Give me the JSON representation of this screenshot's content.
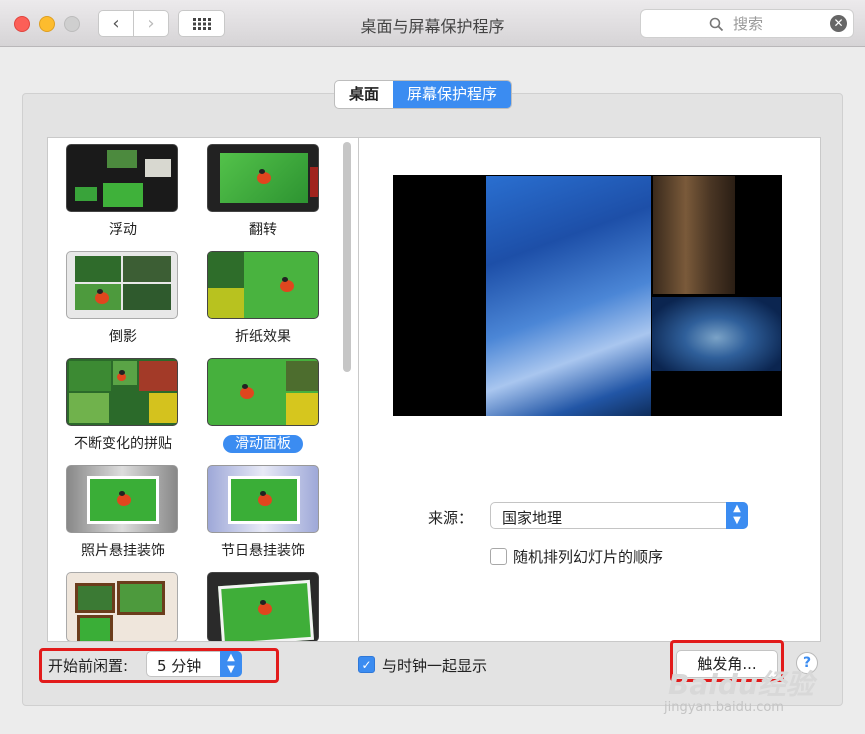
{
  "window": {
    "title": "桌面与屏幕保护程序"
  },
  "toolbar": {
    "back_icon": "chevron-left-icon",
    "forward_icon": "chevron-right-icon",
    "grid_icon": "grid-icon"
  },
  "search": {
    "placeholder": "搜索"
  },
  "tabs": [
    {
      "label": "桌面",
      "selected": false
    },
    {
      "label": "屏幕保护程序",
      "selected": true
    }
  ],
  "screensavers": [
    {
      "label": "浮动",
      "selected": false
    },
    {
      "label": "翻转",
      "selected": false
    },
    {
      "label": "倒影",
      "selected": false
    },
    {
      "label": "折纸效果",
      "selected": false
    },
    {
      "label": "不断变化的拼贴",
      "selected": false
    },
    {
      "label": "滑动面板",
      "selected": true
    },
    {
      "label": "照片悬挂装饰",
      "selected": false
    },
    {
      "label": "节日悬挂装饰",
      "selected": false
    }
  ],
  "source": {
    "label": "来源：",
    "value": "国家地理"
  },
  "shuffle": {
    "label": "随机排列幻灯片的顺序",
    "checked": false
  },
  "idle": {
    "label": "开始前闲置:",
    "value": "5 分钟"
  },
  "clock": {
    "label": "与时钟一起显示",
    "checked": true
  },
  "hot_corners": {
    "label": "触发角..."
  },
  "help": {
    "label": "?"
  },
  "watermark": {
    "brand": "Baidu经验",
    "url": "jingyan.baidu.com"
  },
  "colors": {
    "accent": "#3b8cf1",
    "highlight_box": "#e21b1b"
  }
}
